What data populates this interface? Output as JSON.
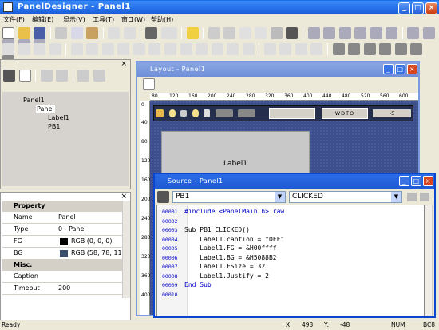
{
  "app": {
    "title": "PanelDesigner - Panel1"
  },
  "menu": [
    "文件(F)",
    "编辑(E)",
    "显示(V)",
    "工具(T)",
    "窗口(W)",
    "帮助(H)"
  ],
  "tree": {
    "root": "Panel1",
    "child": "Panel",
    "items": [
      "Label1",
      "PB1"
    ]
  },
  "props": {
    "header": "Property",
    "rows": [
      {
        "k": "Name",
        "v": "Panel"
      },
      {
        "k": "Type",
        "v": "0 - Panel"
      },
      {
        "k": "FG",
        "v": "RGB (0, 0, 0)",
        "c": "#000000"
      },
      {
        "k": "BG",
        "v": "RGB (58, 78, 11",
        "c": "#3A4E6F"
      }
    ],
    "misc": "Misc.",
    "rows2": [
      {
        "k": "Caption",
        "v": ""
      },
      {
        "k": "Timeout",
        "v": "200"
      }
    ]
  },
  "layout": {
    "title": "Layout - Panel1",
    "ruler": [
      "80",
      "120",
      "160",
      "200",
      "240",
      "280",
      "320",
      "360",
      "400",
      "440",
      "480",
      "520",
      "560",
      "600"
    ],
    "vruler": [
      "0",
      "40",
      "80",
      "120",
      "160",
      "200",
      "240",
      "280",
      "320",
      "360",
      "400"
    ],
    "label": "Label1",
    "btn_text": "WDTO",
    "slider_text": "-5"
  },
  "source": {
    "title": "Source - Panel1",
    "object": "PB1",
    "event": "CLICKED",
    "lines": [
      {
        "n": "00001",
        "t": "#include <PanelMain.h> raw"
      },
      {
        "n": "00002",
        "t": ""
      },
      {
        "n": "00003",
        "t": "Sub PB1_CLICKED()"
      },
      {
        "n": "00004",
        "t": "    Label1.caption = \"OFF\""
      },
      {
        "n": "00005",
        "t": "    Label1.FG = &H00ffff"
      },
      {
        "n": "00006",
        "t": "    Label1.BG = &H5088B2"
      },
      {
        "n": "00007",
        "t": "    Label1.FSize = 32"
      },
      {
        "n": "00008",
        "t": "    Label1.Justify = 2"
      },
      {
        "n": "00009",
        "t": "End Sub"
      },
      {
        "n": "00010",
        "t": ""
      }
    ]
  },
  "status": {
    "ready": "Ready",
    "x_label": "X:",
    "x": "493",
    "y_label": "Y:",
    "y": "-48",
    "mode": "NUM",
    "kb": "BC8"
  }
}
